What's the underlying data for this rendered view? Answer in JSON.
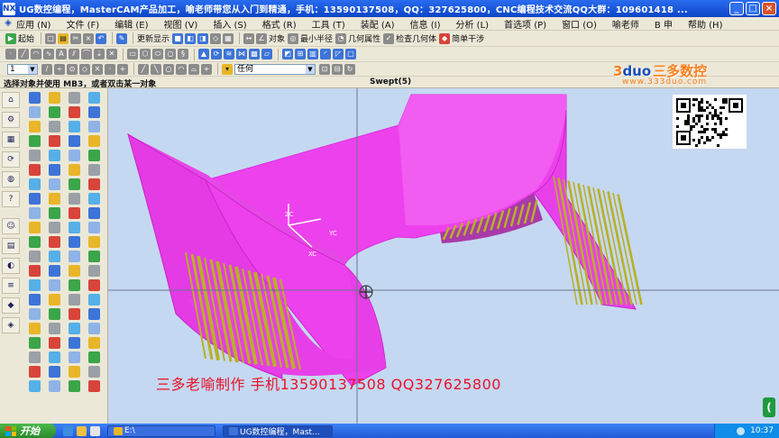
{
  "window": {
    "title": "UG数控编程，MasterCAM产品加工，喻老师带您从入门到精通，手机：13590137508，QQ：327625800，CNC编程技术交流QQ大群：109601418 ...",
    "icon_label": "NX",
    "minimize": "_",
    "restore": "□",
    "close": "×"
  },
  "menubar": {
    "items": [
      "应用 (N)",
      "文件 (F)",
      "编辑 (E)",
      "视图 (V)",
      "插入 (S)",
      "格式 (R)",
      "工具 (T)",
      "装配 (A)",
      "信息 (I)",
      "分析 (L)",
      "首选项 (P)",
      "窗口 (O)",
      "喻老师",
      "B 申",
      "帮助 (H)"
    ]
  },
  "toolbar1": {
    "start_label": "起始",
    "more_display": "更新显示",
    "object_label": "对象",
    "min_radius": "最小半径",
    "geom_props": "几何属性",
    "check_geom": "检查几何体",
    "simple_interference": "简单干涉"
  },
  "toolbar2": {
    "layer_value": "1",
    "selection_filter": "任何"
  },
  "cue": {
    "prompt": "选择对象并使用 MB3，或者双击某一对象",
    "status": "Swept(5)"
  },
  "viewport": {
    "wcs_x_label": "XC",
    "wcs_y_label": "YC",
    "wcs_z_label": "ZC",
    "model_color": "#ee41ee",
    "stripe_color": "#b9b025"
  },
  "logo": {
    "brand_num": "3",
    "brand_word": "duo",
    "brand_cn": "三多数控",
    "url": "www.333duo.com"
  },
  "watermark": {
    "text": "三多老喻制作  手机13590137508  QQ327625800"
  },
  "taskbar": {
    "start": "开始",
    "task1": "E:\\",
    "task2": "UG数控编程，Mast...",
    "clock": "10:37"
  },
  "side_handle": "("
}
